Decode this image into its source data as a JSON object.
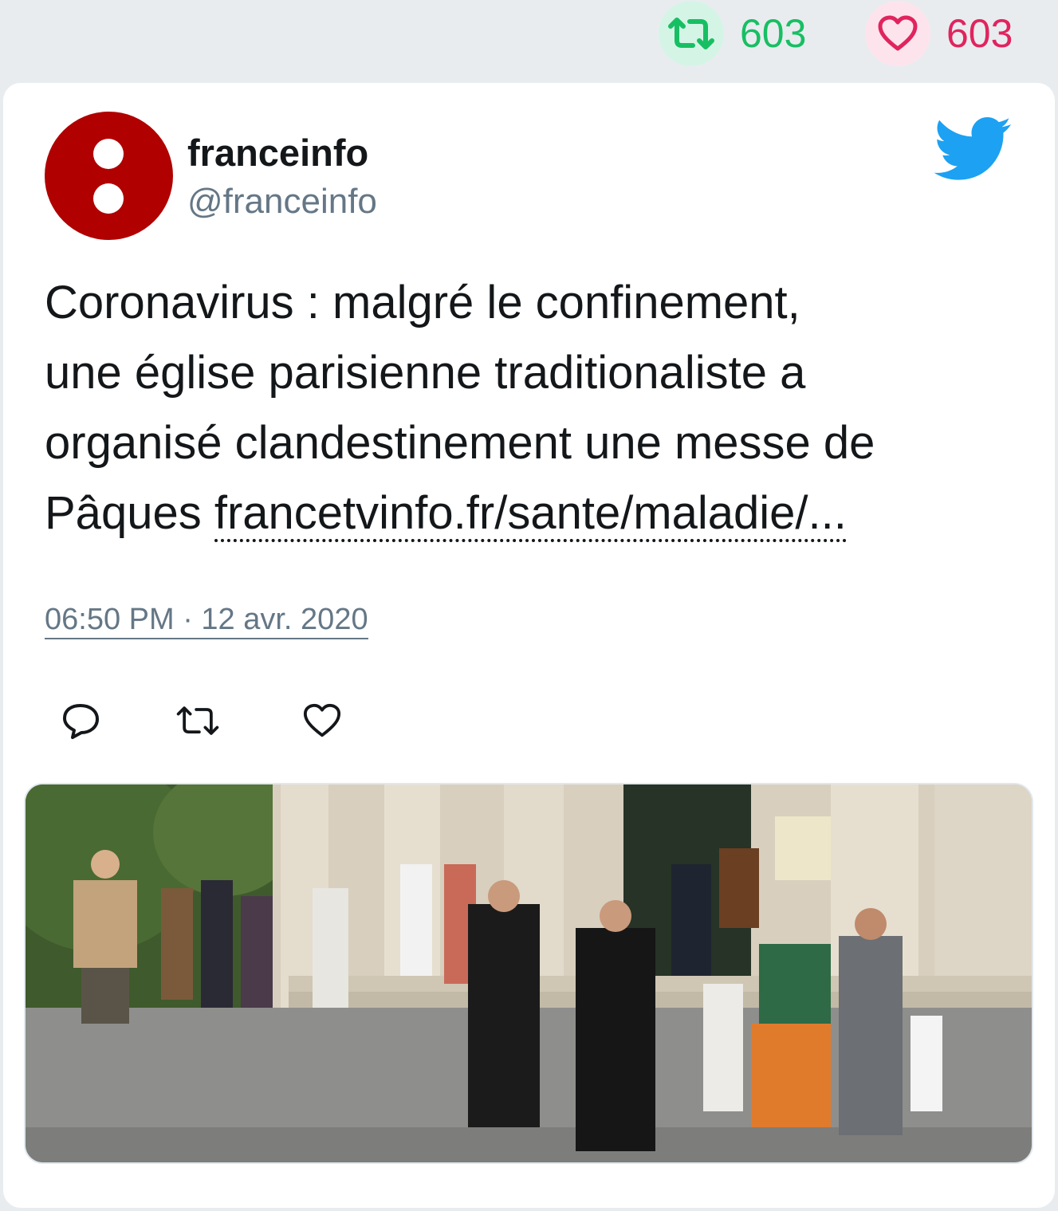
{
  "stats": {
    "retweets": "603",
    "likes": "603"
  },
  "tweet": {
    "author_name": "franceinfo",
    "author_handle": "@franceinfo",
    "text_line1": "Coronavirus : malgré le confinement,",
    "text_line2": "une église parisienne traditionaliste a",
    "text_line3": "organisé clandestinement une messe de",
    "text_line4_prefix": "Pâques ",
    "link": "francetvinfo.fr/sante/maladie/...",
    "timestamp": "06:50 PM · 12 avr. 2020"
  },
  "colors": {
    "retweet": "#17bf63",
    "like": "#e0245e",
    "twitter_blue": "#1da1f2",
    "avatar_red": "#b00000",
    "muted": "#657786"
  },
  "icons": [
    "retweet-icon",
    "heart-icon",
    "twitter-bird-icon",
    "reply-icon"
  ]
}
